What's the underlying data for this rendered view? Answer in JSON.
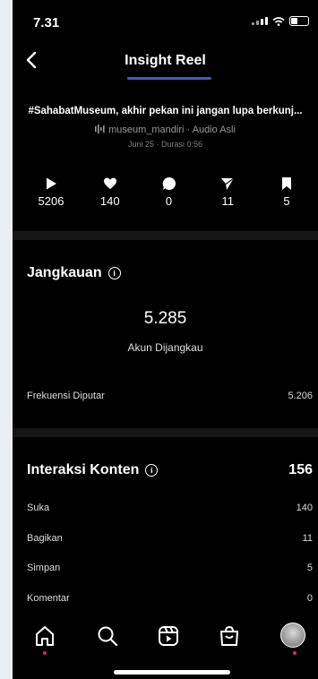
{
  "status": {
    "time": "7.31"
  },
  "nav": {
    "title": "Insight Reel"
  },
  "post": {
    "caption": "#SahabatMuseum, akhir pekan ini jangan lupa berkunj...",
    "audio": "museum_mandiri · Audio Asli",
    "meta": "Juni 25 · Durasi 0:56"
  },
  "stats": [
    {
      "icon": "play-icon",
      "value": "5206"
    },
    {
      "icon": "heart-icon",
      "value": "140"
    },
    {
      "icon": "comment-icon",
      "value": "0"
    },
    {
      "icon": "share-icon",
      "value": "11"
    },
    {
      "icon": "bookmark-icon",
      "value": "5"
    }
  ],
  "reach": {
    "title": "Jangkauan",
    "accounts_value": "5.285",
    "accounts_label": "Akun Dijangkau",
    "freq_label": "Frekuensi Diputar",
    "freq_value": "5.206"
  },
  "interactions": {
    "title": "Interaksi Konten",
    "total": "156",
    "rows": [
      {
        "label": "Suka",
        "value": "140"
      },
      {
        "label": "Bagikan",
        "value": "11"
      },
      {
        "label": "Simpan",
        "value": "5"
      },
      {
        "label": "Komentar",
        "value": "0"
      }
    ]
  },
  "tabs": [
    "home-icon",
    "search-icon",
    "reels-icon",
    "shop-icon",
    "profile-avatar"
  ],
  "colors": {
    "accent": "#3b5bd6",
    "notification": "#e0245e",
    "background": "#000000"
  }
}
